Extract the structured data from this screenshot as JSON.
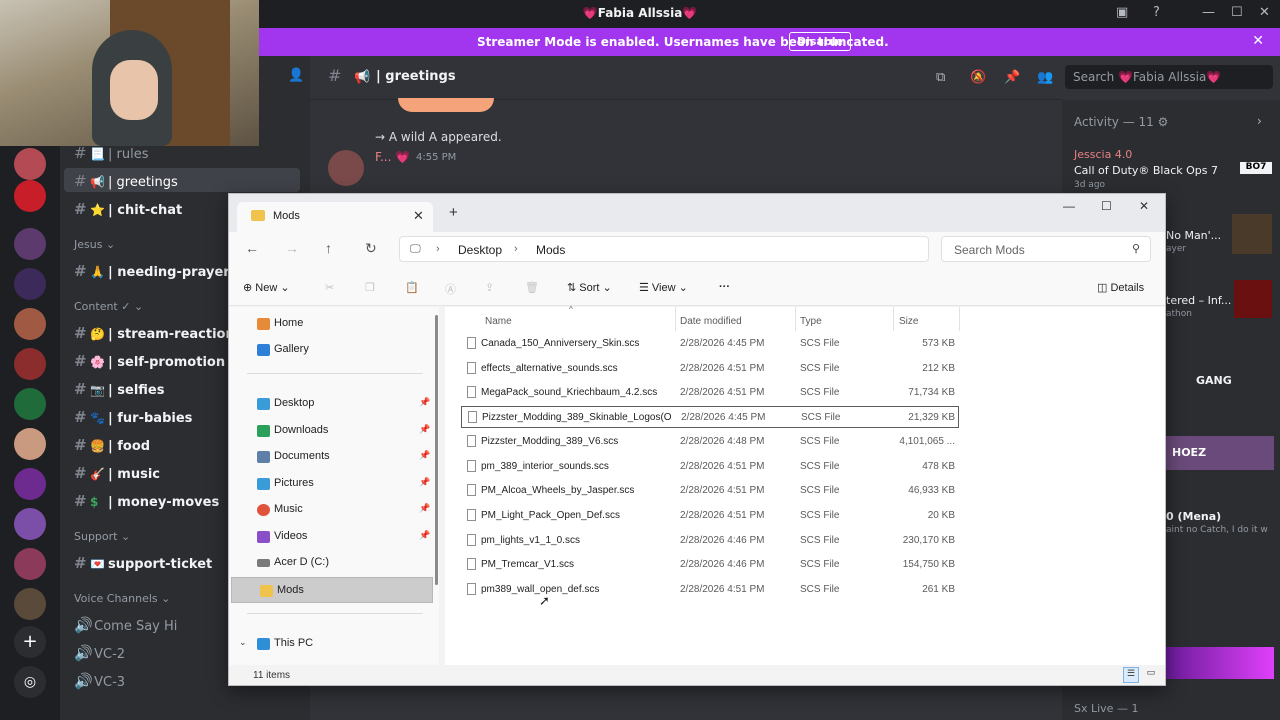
{
  "discord": {
    "window_title": "💗Fabia Allssia💗",
    "streamer_banner": "Streamer Mode is enabled. Usernames have been truncated.",
    "streamer_disable": "Disable",
    "channel_name": "| greetings",
    "search_placeholder": "Search 💗Fabia Allssia💗",
    "channels": [
      {
        "emoji": "📃",
        "label": "| rules"
      },
      {
        "emoji": "📢",
        "label": "| greetings"
      },
      {
        "emoji": "⭐",
        "label": "| chit-chat"
      },
      {
        "emoji": "🙏",
        "label": "| needing-prayer"
      },
      {
        "emoji": "🤔",
        "label": "| stream-reactions"
      },
      {
        "emoji": "🌸",
        "label": "| self-promotion"
      },
      {
        "emoji": "📷",
        "label": "| selfies"
      },
      {
        "emoji": "🐾",
        "label": "| fur-babies"
      },
      {
        "emoji": "🍔",
        "label": "| food"
      },
      {
        "emoji": "🎸",
        "label": "| music"
      },
      {
        "emoji": "$",
        "label": "| money-moves"
      },
      {
        "emoji": "💌",
        "label": "support-ticket"
      }
    ],
    "categories": {
      "jesus": "Jesus",
      "content": "Content",
      "support": "Support",
      "voice": "Voice Channels"
    },
    "voice_channels": [
      "Come Say Hi",
      "VC-2",
      "VC-3"
    ],
    "chat": {
      "system_message": "A wild A appeared.",
      "author": "F...",
      "timestamp": "4:55 PM"
    },
    "activity": {
      "title": "Activity — 11",
      "game_user": "Jesscia 4.0",
      "game_title": "Call of Duty® Black Ops 7",
      "game_time": "3d ago",
      "snippets": [
        "No Man'...",
        "ayer",
        "tered – Inf...",
        "athon",
        "GANG",
        "HOEZ",
        "0 (Mena)",
        "aint no Catch, I do it w"
      ],
      "sx_live": "Sx Live — 1"
    }
  },
  "explorer": {
    "tab_title": "Mods",
    "breadcrumb": [
      "Desktop",
      "Mods"
    ],
    "search_placeholder": "Search Mods",
    "commands": {
      "new": "New",
      "sort": "Sort",
      "view": "View",
      "more": "···",
      "details": "Details"
    },
    "sidebar": {
      "home": "Home",
      "gallery": "Gallery",
      "desktop": "Desktop",
      "downloads": "Downloads",
      "documents": "Documents",
      "pictures": "Pictures",
      "music": "Music",
      "videos": "Videos",
      "acer": "Acer D (C:)",
      "mods": "Mods",
      "this_pc": "This PC"
    },
    "columns": {
      "name": "Name",
      "date": "Date modified",
      "type": "Type",
      "size": "Size"
    },
    "files": [
      {
        "name": "Canada_150_Anniversery_Skin.scs",
        "date": "2/28/2026 4:45 PM",
        "type": "SCS File",
        "size": "573 KB"
      },
      {
        "name": "effects_alternative_sounds.scs",
        "date": "2/28/2026 4:51 PM",
        "type": "SCS File",
        "size": "212 KB"
      },
      {
        "name": "MegaPack_sound_Kriechbaum_4.2.scs",
        "date": "2/28/2026 4:51 PM",
        "type": "SCS File",
        "size": "71,734 KB"
      },
      {
        "name": "Pizzster_Modding_389_Skinable_Logos(O...",
        "date": "2/28/2026 4:45 PM",
        "type": "SCS File",
        "size": "21,329 KB"
      },
      {
        "name": "Pizzster_Modding_389_V6.scs",
        "date": "2/28/2026 4:48 PM",
        "type": "SCS File",
        "size": "4,101,065 ..."
      },
      {
        "name": "pm_389_interior_sounds.scs",
        "date": "2/28/2026 4:51 PM",
        "type": "SCS File",
        "size": "478 KB"
      },
      {
        "name": "PM_Alcoa_Wheels_by_Jasper.scs",
        "date": "2/28/2026 4:51 PM",
        "type": "SCS File",
        "size": "46,933 KB"
      },
      {
        "name": "PM_Light_Pack_Open_Def.scs",
        "date": "2/28/2026 4:51 PM",
        "type": "SCS File",
        "size": "20 KB"
      },
      {
        "name": "pm_lights_v1_1_0.scs",
        "date": "2/28/2026 4:46 PM",
        "type": "SCS File",
        "size": "230,170 KB"
      },
      {
        "name": "PM_Tremcar_V1.scs",
        "date": "2/28/2026 4:46 PM",
        "type": "SCS File",
        "size": "154,750 KB"
      },
      {
        "name": "pm389_wall_open_def.scs",
        "date": "2/28/2026 4:51 PM",
        "type": "SCS File",
        "size": "261 KB"
      }
    ],
    "status": "11 items"
  }
}
